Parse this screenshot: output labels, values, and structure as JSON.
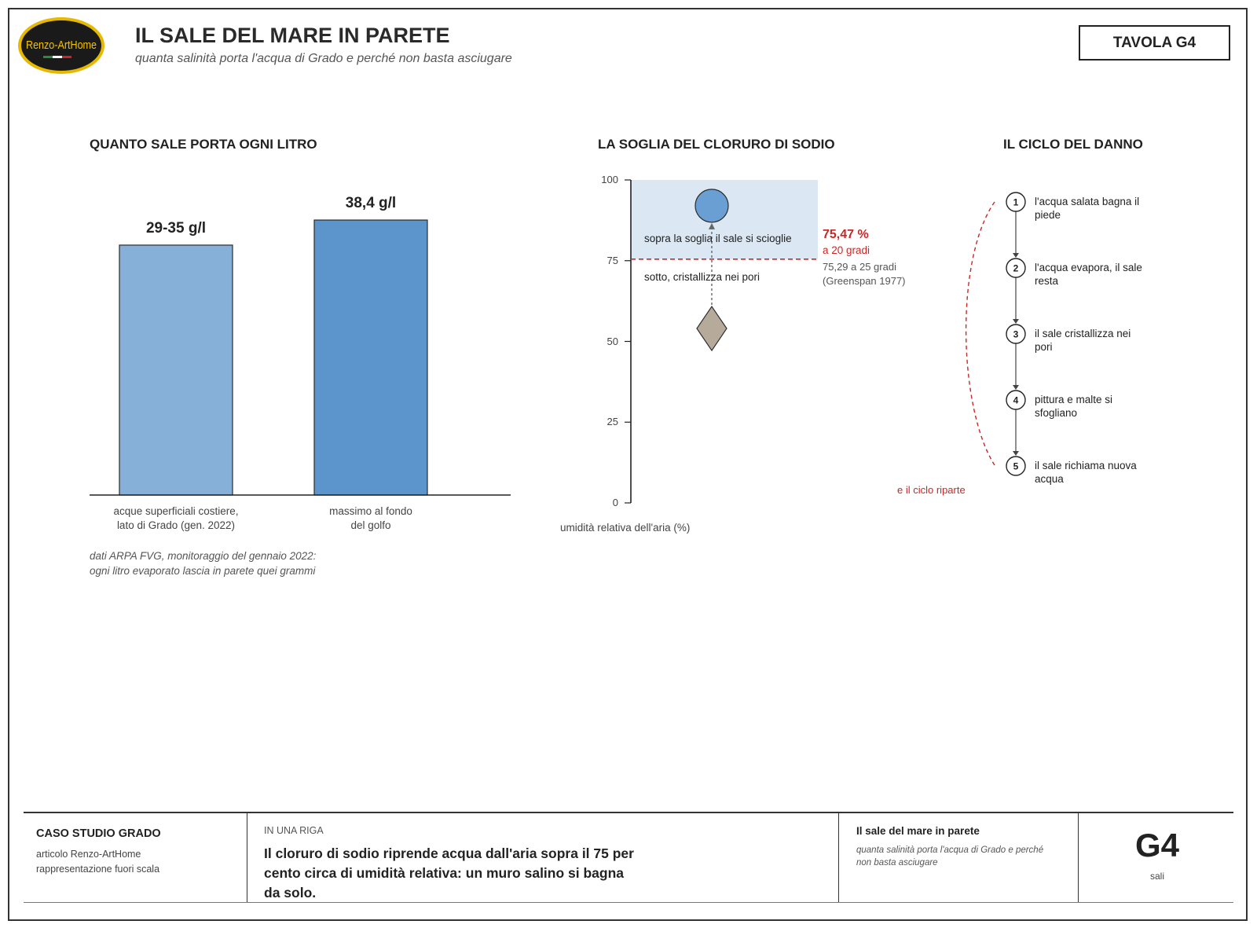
{
  "header": {
    "logo_text": "Renzo-ArtHome",
    "title": "IL SALE DEL MARE IN PARETE",
    "subtitle": "quanta salinità porta l'acqua di Grado e perché non basta asciugare",
    "tavola": "TAVOLA G4"
  },
  "bar_section": {
    "heading": "QUANTO SALE PORTA OGNI LITRO",
    "note_line1": "dati ARPA FVG, monitoraggio del gennaio 2022:",
    "note_line2": "ogni litro evaporato lascia in parete quei grammi"
  },
  "threshold_section": {
    "heading": "LA SOGLIA DEL CLORURO DI SODIO",
    "above_label": "sopra la soglia il sale si scioglie",
    "below_label": "sotto, cristallizza nei pori",
    "threshold_value": "75,47 %",
    "threshold_temp": "a 20 gradi",
    "alt_value": "75,29 a 25 gradi",
    "source": "(Greenspan 1977)",
    "axis_label": "umidità relativa dell'aria (%)"
  },
  "cycle_section": {
    "heading": "IL CICLO DEL DANNO",
    "steps": [
      {
        "num": "1",
        "line1": "l'acqua salata bagna il",
        "line2": "piede"
      },
      {
        "num": "2",
        "line1": "l'acqua evapora, il sale",
        "line2": "resta"
      },
      {
        "num": "3",
        "line1": "il sale cristallizza nei",
        "line2": "pori"
      },
      {
        "num": "4",
        "line1": "pittura e malte si",
        "line2": "sfogliano"
      },
      {
        "num": "5",
        "line1": "il sale richiama nuova",
        "line2": "acqua"
      }
    ],
    "restart_label": "e il ciclo riparte"
  },
  "chart_data": [
    {
      "type": "bar",
      "title": "QUANTO SALE PORTA OGNI LITRO",
      "categories": [
        "acque superficiali costiere, lato di Grado (gen. 2022)",
        "massimo al fondo del golfo"
      ],
      "category_lines": [
        [
          "acque superficiali costiere,",
          "lato di Grado (gen. 2022)"
        ],
        [
          "massimo al fondo",
          "del golfo"
        ]
      ],
      "values": [
        34.9,
        38.4
      ],
      "value_range": [
        29,
        35
      ],
      "data_labels": [
        "29-35 g/l",
        "38,4 g/l"
      ],
      "colors": [
        "#86b0d8",
        "#5b95cb"
      ],
      "ylim": [
        0,
        44
      ],
      "xlabel": "",
      "ylabel": "",
      "grid": false
    },
    {
      "type": "scatter",
      "title": "LA SOGLIA DEL CLORURO DI SODIO",
      "ylabel": "umidità relativa dell'aria (%)",
      "ylim": [
        0,
        100
      ],
      "yticks": [
        "0",
        "25",
        "50",
        "75",
        "100"
      ],
      "threshold": 75.47,
      "points": [
        {
          "shape": "circle",
          "y": 92,
          "color": "#6a9fd4"
        },
        {
          "shape": "diamond",
          "y": 54,
          "color": "#b6ab9a"
        }
      ],
      "grid": false
    }
  ],
  "footer": {
    "col1_head": "CASO STUDIO GRADO",
    "col1_line1": "articolo Renzo-ArtHome",
    "col1_line2": "rappresentazione fuori scala",
    "col2_label": "IN UNA RIGA",
    "col2_text": "Il cloruro di sodio riprende acqua dall'aria sopra il 75 per cento circa di umidità relativa: un muro salino si bagna da solo.",
    "col3_head": "Il sale del mare in parete",
    "col3_text": "quanta salinità porta l'acqua di Grado e perché non basta asciugare",
    "code": "G4",
    "code_sub": "sali"
  }
}
